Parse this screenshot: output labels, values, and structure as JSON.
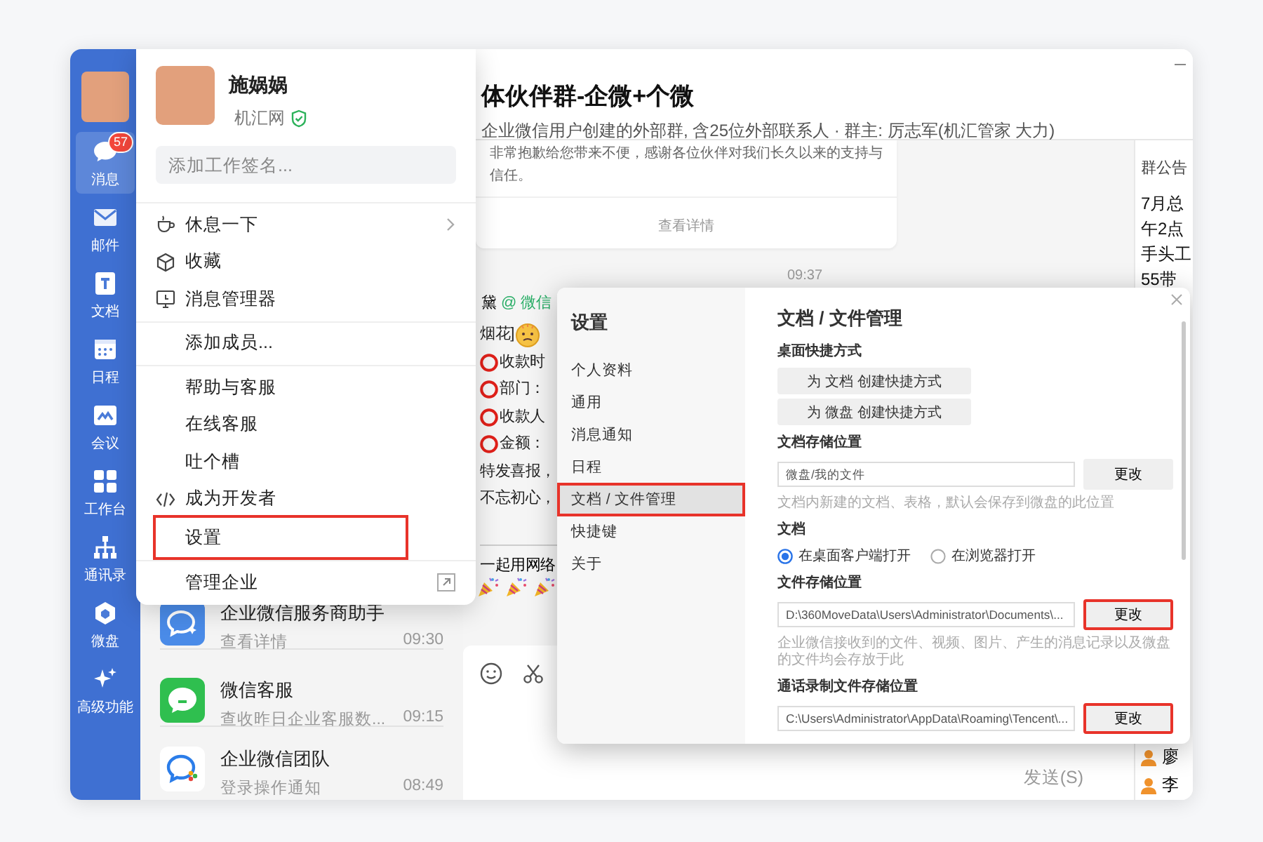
{
  "sidebar": {
    "items": [
      {
        "label": "消息",
        "badge": "57",
        "selected": true
      },
      {
        "label": "邮件",
        "selected": false
      },
      {
        "label": "文档",
        "selected": false
      },
      {
        "label": "日程",
        "selected": false
      },
      {
        "label": "会议",
        "selected": false
      },
      {
        "label": "工作台",
        "selected": false
      },
      {
        "label": "通讯录",
        "selected": false
      },
      {
        "label": "微盘",
        "selected": false
      },
      {
        "label": "高级功能",
        "selected": false
      }
    ]
  },
  "chat_list": {
    "items": [
      {
        "name": "企业微信服务商助手",
        "preview": "查看详情",
        "time": "09:30"
      },
      {
        "name": "微信客服",
        "preview": "查收昨日企业客服数...",
        "time": "09:15"
      },
      {
        "name": "企业微信团队",
        "preview": "登录操作通知",
        "time": "08:49"
      }
    ]
  },
  "chat": {
    "title": "体伙伴群-企微+个微",
    "subtitle": "企业微信用户创建的外部群, 含25位外部联系人 · 群主: 厉志军(机汇管家 大力)",
    "card": {
      "lines": [
        "非常抱歉给您带来不便，感谢各位伙伴对我们长久以来的支持与",
        "信任。"
      ],
      "link": "查看详情"
    },
    "time": "09:37",
    "sender": "黛",
    "sender_tag": "@ 微信",
    "message": [
      {
        "kind": "emoji",
        "text": "烟花]"
      },
      {
        "kind": "circle",
        "text": "收款时"
      },
      {
        "kind": "circle",
        "text": "部门："
      },
      {
        "kind": "circle",
        "text": "收款人"
      },
      {
        "kind": "circle",
        "text": "金额："
      },
      {
        "kind": "plain",
        "text": "特发喜报，"
      },
      {
        "kind": "plain",
        "text": "不忘初心，"
      }
    ],
    "followup": "一起用网络",
    "send": "发送(S)"
  },
  "notice": {
    "title": "群公告",
    "lines": [
      "7月总",
      "午2点",
      "手头工",
      "55带"
    ],
    "members": [
      "廖",
      "李"
    ]
  },
  "menu": {
    "name": "施娲娲",
    "org": "机汇网",
    "verified": true,
    "signature_placeholder": "添加工作签名...",
    "groups": [
      [
        {
          "kind": "break",
          "label": "休息一下",
          "highlighted": false
        },
        {
          "kind": "favorites",
          "label": "收藏",
          "highlighted": false
        },
        {
          "kind": "message-manager",
          "label": "消息管理器",
          "highlighted": false
        }
      ],
      [
        {
          "kind": "plain",
          "label": "添加成员...",
          "highlighted": false
        }
      ],
      [
        {
          "kind": "plain",
          "label": "帮助与客服",
          "highlighted": false
        },
        {
          "kind": "plain",
          "label": "在线客服",
          "highlighted": false
        },
        {
          "kind": "plain",
          "label": "吐个槽",
          "highlighted": false
        },
        {
          "kind": "developer",
          "label": "成为开发者",
          "highlighted": false
        },
        {
          "kind": "plain",
          "label": "设置",
          "highlighted": true
        }
      ],
      [
        {
          "kind": "manage",
          "label": "管理企业",
          "highlighted": false
        }
      ]
    ]
  },
  "settings": {
    "title": "设置",
    "nav": [
      {
        "label": "个人资料",
        "selected": false,
        "highlighted": false
      },
      {
        "label": "通用",
        "selected": false,
        "highlighted": false
      },
      {
        "label": "消息通知",
        "selected": false,
        "highlighted": false
      },
      {
        "label": "日程",
        "selected": false,
        "highlighted": false
      },
      {
        "label": "文档 / 文件管理",
        "selected": true,
        "highlighted": true
      },
      {
        "label": "快捷键",
        "selected": false,
        "highlighted": false
      },
      {
        "label": "关于",
        "selected": false,
        "highlighted": false
      }
    ],
    "heading": "文档 / 文件管理",
    "sections": [
      {
        "kind": "buttons",
        "title": "桌面快捷方式",
        "buttons": [
          "为 文档 创建快捷方式",
          "为 微盘 创建快捷方式"
        ]
      },
      {
        "kind": "path",
        "title": "文档存储位置",
        "value": "微盘/我的文件",
        "button": "更改",
        "highlighted": false,
        "hint": "文档内新建的文档、表格，默认会保存到微盘的此位置"
      },
      {
        "kind": "radio",
        "title": "文档",
        "options": [
          {
            "label": "在桌面客户端打开",
            "selected": true
          },
          {
            "label": "在浏览器打开",
            "selected": false
          }
        ]
      },
      {
        "kind": "path",
        "title": "文件存储位置",
        "value": "D:\\360MoveData\\Users\\Administrator\\Documents\\...",
        "button": "更改",
        "highlighted": true,
        "hint": "企业微信接收到的文件、视频、图片、产生的消息记录以及微盘的文件均会存放于此"
      },
      {
        "kind": "path",
        "title": "通话录制文件存储位置",
        "value": "C:\\Users\\Administrator\\AppData\\Roaming\\Tencent\\...",
        "button": "更改",
        "highlighted": true
      }
    ]
  }
}
